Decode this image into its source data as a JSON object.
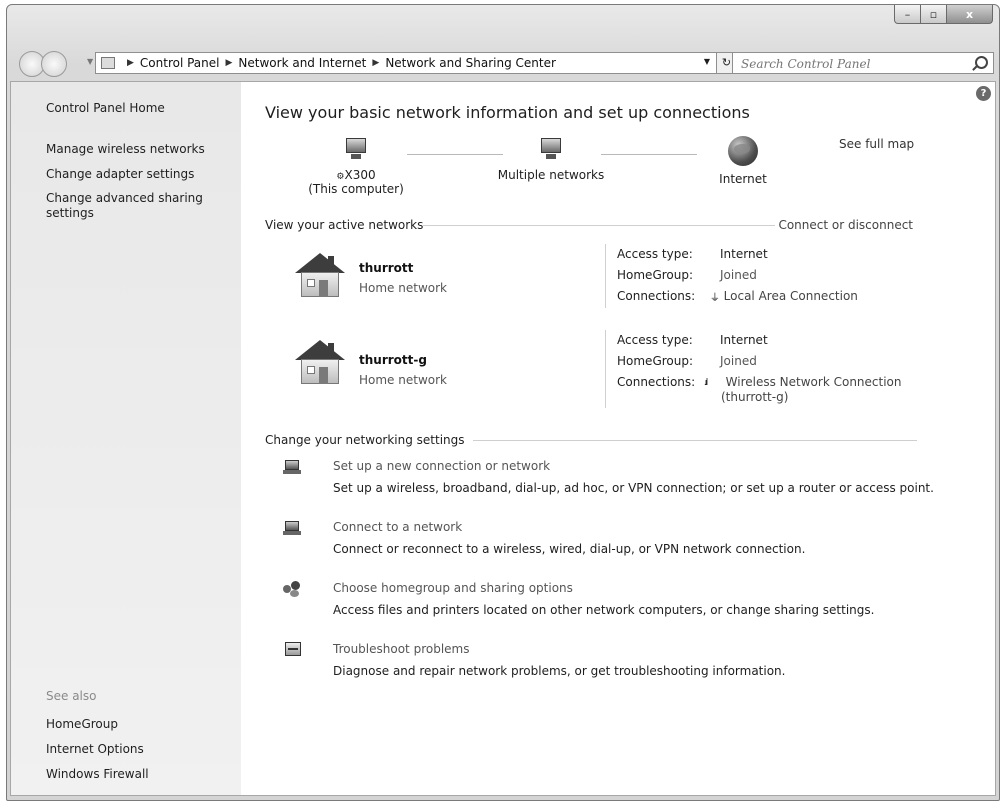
{
  "window": {
    "caption_min": "–",
    "caption_max": "▫",
    "caption_close": "x"
  },
  "address_bar": {
    "crumbs": [
      "Control Panel",
      "Network and Internet",
      "Network and Sharing Center"
    ],
    "search_placeholder": "Search Control Panel"
  },
  "sidebar": {
    "home": "Control Panel Home",
    "links": [
      "Manage wireless networks",
      "Change adapter settings",
      "Change advanced sharing settings"
    ],
    "see_also_heading": "See also",
    "see_also": [
      "HomeGroup",
      "Internet Options",
      "Windows Firewall"
    ]
  },
  "main": {
    "title": "View your basic network information and set up connections",
    "see_full_map": "See full map",
    "map": {
      "computer_name": "X300",
      "computer_sub": "(This computer)",
      "middle": "Multiple networks",
      "internet": "Internet"
    },
    "active_networks_heading": "View your active networks",
    "connect_or_disconnect": "Connect or disconnect",
    "access_type_label": "Access type:",
    "homegroup_label": "HomeGroup:",
    "connections_label": "Connections:",
    "networks": [
      {
        "name": "thurrott",
        "type": "Home network",
        "access_type": "Internet",
        "homegroup": "Joined",
        "connection": "Local Area Connection",
        "connection_line2": ""
      },
      {
        "name": "thurrott-g",
        "type": "Home network",
        "access_type": "Internet",
        "homegroup": "Joined",
        "connection": "Wireless Network Connection",
        "connection_line2": "(thurrott-g)"
      }
    ],
    "change_settings_heading": "Change your networking settings",
    "tasks": [
      {
        "title": "Set up a new connection or network",
        "desc": "Set up a wireless, broadband, dial-up, ad hoc, or VPN connection; or set up a router or access point."
      },
      {
        "title": "Connect to a network",
        "desc": "Connect or reconnect to a wireless, wired, dial-up, or VPN network connection."
      },
      {
        "title": "Choose homegroup and sharing options",
        "desc": "Access files and printers located on other network computers, or change sharing settings."
      },
      {
        "title": "Troubleshoot problems",
        "desc": "Diagnose and repair network problems, or get troubleshooting information."
      }
    ]
  }
}
